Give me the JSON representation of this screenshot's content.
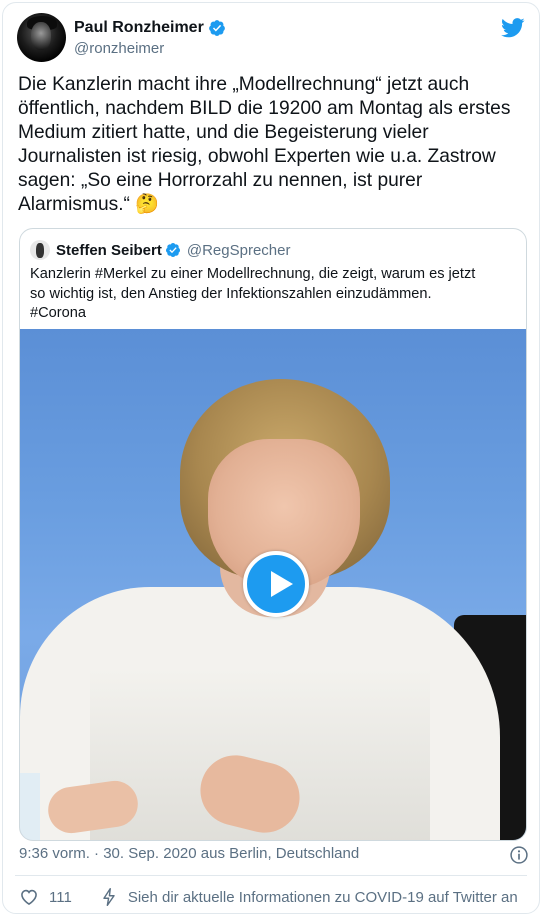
{
  "author": {
    "display_name": "Paul Ronzheimer",
    "handle": "@ronzheimer"
  },
  "tweet": {
    "lines": [
      "Die Kanzlerin macht ihre „Modellrechnung“ jetzt auch",
      "öffentlich, nachdem BILD die 19200 am Montag als erstes",
      "Medium zitiert hatte, und die Begeisterung vieler",
      "Journalisten ist riesig, obwohl Experten wie u.a. Zastrow",
      "sagen: „So eine Horrorzahl zu nennen, ist purer",
      "Alarmismus.“ 🤔"
    ]
  },
  "quoted": {
    "display_name": "Steffen Seibert",
    "handle": "@RegSprecher",
    "lines": [
      "Kanzlerin #Merkel zu einer Modellrechnung, die zeigt, warum es jetzt",
      "so wichtig ist, den Anstieg der Infektionszahlen einzudämmen.",
      "#Corona"
    ]
  },
  "meta": {
    "timestamp": "9:36 vorm. · 30. Sep. 2020 aus Berlin, Deutschland"
  },
  "actions": {
    "likes": "111",
    "covid_info": "Sieh dir aktuelle Informationen zu COVID-19 auf Twitter an"
  },
  "colors": {
    "accent": "#1d9bf0",
    "text": "#0f1419",
    "secondary": "#5b7083",
    "border": "#cfd9de"
  },
  "icons": [
    "twitter-bird-icon",
    "verified-badge-icon",
    "play-icon",
    "info-icon",
    "heart-icon",
    "lightning-icon"
  ]
}
